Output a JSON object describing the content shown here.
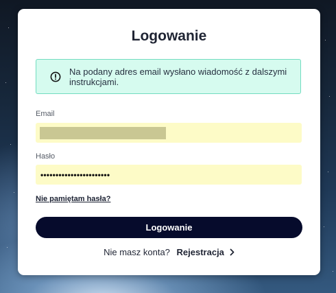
{
  "login": {
    "title": "Logowanie",
    "alert_text": "Na podany adres email wysłano wiadomość z dalszymi instrukcjami.",
    "email_label": "Email",
    "email_value": "",
    "password_label": "Hasło",
    "password_mask": "•••••••••••••••••••••••",
    "forgot_link": "Nie pamiętam hasła?",
    "submit_label": "Logowanie",
    "register_prompt": "Nie masz konta?",
    "register_link": "Rejestracja"
  },
  "icons": {
    "alert": "info-circle-icon",
    "register_arrow": "chevron-right-icon"
  },
  "colors": {
    "primary_button": "#060b2c",
    "alert_background": "#d6fbef",
    "alert_border": "#72dcc0",
    "input_autofill": "#fdfbc7"
  }
}
